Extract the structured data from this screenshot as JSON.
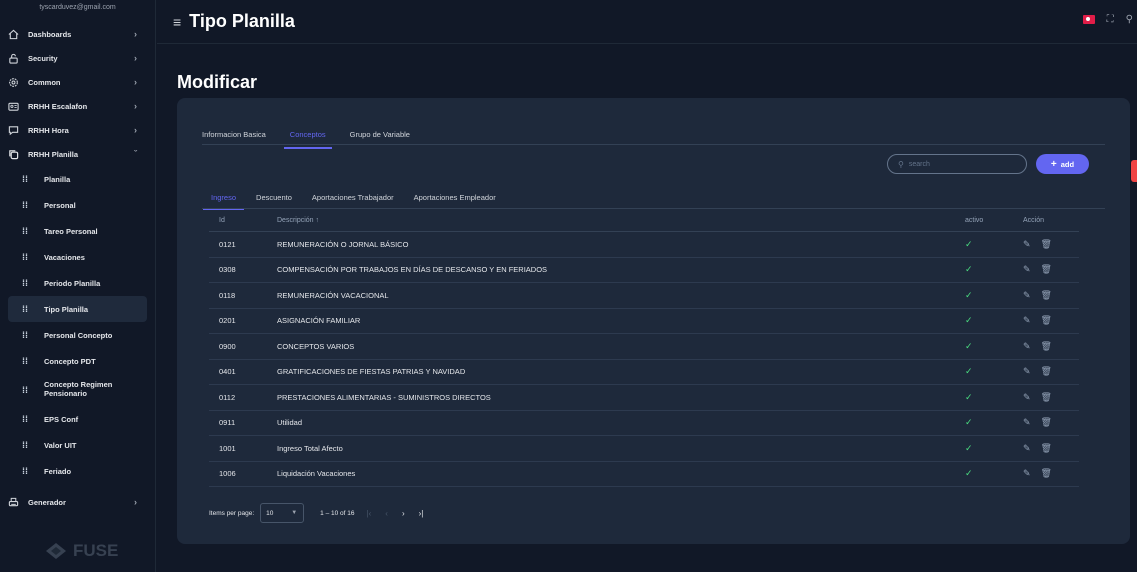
{
  "user": {
    "email": "tyscarduvez@gmail.com"
  },
  "sidebar": {
    "items": [
      {
        "label": "Dashboards",
        "icon": "home-icon"
      },
      {
        "label": "Security",
        "icon": "lock-icon"
      },
      {
        "label": "Common",
        "icon": "gear-icon"
      },
      {
        "label": "RRHH Escalafon",
        "icon": "id-card-icon"
      },
      {
        "label": "RRHH Hora",
        "icon": "chat-icon"
      },
      {
        "label": "RRHH Planilla",
        "icon": "copy-icon"
      }
    ],
    "subitems": [
      {
        "label": "Planilla"
      },
      {
        "label": "Personal"
      },
      {
        "label": "Tareo Personal"
      },
      {
        "label": "Vacaciones"
      },
      {
        "label": "Periodo Planilla"
      },
      {
        "label": "Tipo Planilla"
      },
      {
        "label": "Personal Concepto"
      },
      {
        "label": "Concepto PDT"
      },
      {
        "label": "Concepto Regimen Pensionario"
      },
      {
        "label": "EPS Conf"
      },
      {
        "label": "Valor UIT"
      },
      {
        "label": "Feriado"
      }
    ],
    "generador": {
      "label": "Generador"
    },
    "brand": "FUSE"
  },
  "header": {
    "title": "Tipo Planilla"
  },
  "page": {
    "heading": "Modificar"
  },
  "tabs": [
    "Informacion Basica",
    "Conceptos",
    "Grupo de Variable"
  ],
  "search": {
    "placeholder": "search"
  },
  "add_label": "add",
  "subtabs": [
    "Ingreso",
    "Descuento",
    "Aportaciones Trabajador",
    "Aportaciones Empleador"
  ],
  "table": {
    "headers": {
      "id": "Id",
      "desc": "Descripción ↑",
      "active": "activo",
      "action": "Acción"
    },
    "rows": [
      {
        "id": "0121",
        "desc": "REMUNERACIÓN O JORNAL BÁSICO"
      },
      {
        "id": "0308",
        "desc": "COMPENSACIÓN POR TRABAJOS EN DÍAS DE DESCANSO Y EN FERIADOS"
      },
      {
        "id": "0118",
        "desc": "REMUNERACIÓN VACACIONAL"
      },
      {
        "id": "0201",
        "desc": "ASIGNACIÓN FAMILIAR"
      },
      {
        "id": "0900",
        "desc": "CONCEPTOS VARIOS"
      },
      {
        "id": "0401",
        "desc": "GRATIFICACIONES DE FIESTAS PATRIAS Y NAVIDAD"
      },
      {
        "id": "0112",
        "desc": "PRESTACIONES ALIMENTARIAS - SUMINISTROS DIRECTOS"
      },
      {
        "id": "0911",
        "desc": "Utilidad"
      },
      {
        "id": "1001",
        "desc": "Ingreso Total Afecto"
      },
      {
        "id": "1006",
        "desc": "Liquidación Vacaciones"
      }
    ]
  },
  "pager": {
    "label": "Items per page:",
    "size": "10",
    "range": "1 – 10 of 16"
  }
}
